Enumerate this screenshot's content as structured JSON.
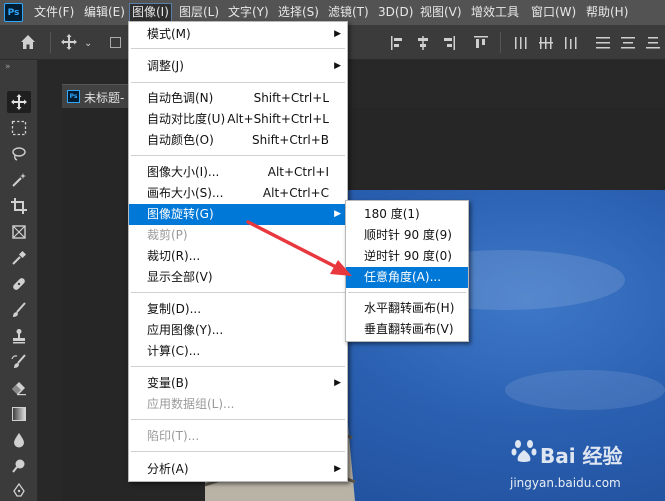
{
  "app": {
    "logo": "Ps"
  },
  "menubar": {
    "items": [
      "文件(F)",
      "编辑(E)",
      "图像(I)",
      "图层(L)",
      "文字(Y)",
      "选择(S)",
      "滤镜(T)",
      "3D(D)",
      "视图(V)",
      "增效工具",
      "窗口(W)",
      "帮助(H)"
    ],
    "active_index": 2
  },
  "document": {
    "tab_title": "未标题-"
  },
  "image_menu": {
    "items": [
      {
        "label": "模式(M)",
        "shortcut": "",
        "submenu": true,
        "disabled": false
      },
      {
        "label": "调整(J)",
        "shortcut": "",
        "submenu": true,
        "disabled": false
      },
      {
        "label": "自动色调(N)",
        "shortcut": "Shift+Ctrl+L",
        "submenu": false,
        "disabled": false
      },
      {
        "label": "自动对比度(U)",
        "shortcut": "Alt+Shift+Ctrl+L",
        "submenu": false,
        "disabled": false
      },
      {
        "label": "自动颜色(O)",
        "shortcut": "Shift+Ctrl+B",
        "submenu": false,
        "disabled": false
      },
      {
        "label": "图像大小(I)...",
        "shortcut": "Alt+Ctrl+I",
        "submenu": false,
        "disabled": false
      },
      {
        "label": "画布大小(S)...",
        "shortcut": "Alt+Ctrl+C",
        "submenu": false,
        "disabled": false
      },
      {
        "label": "图像旋转(G)",
        "shortcut": "",
        "submenu": true,
        "disabled": false,
        "highlighted": true
      },
      {
        "label": "裁剪(P)",
        "shortcut": "",
        "submenu": false,
        "disabled": true
      },
      {
        "label": "裁切(R)...",
        "shortcut": "",
        "submenu": false,
        "disabled": false
      },
      {
        "label": "显示全部(V)",
        "shortcut": "",
        "submenu": false,
        "disabled": false
      },
      {
        "label": "复制(D)...",
        "shortcut": "",
        "submenu": false,
        "disabled": false
      },
      {
        "label": "应用图像(Y)...",
        "shortcut": "",
        "submenu": false,
        "disabled": false
      },
      {
        "label": "计算(C)...",
        "shortcut": "",
        "submenu": false,
        "disabled": false
      },
      {
        "label": "变量(B)",
        "shortcut": "",
        "submenu": true,
        "disabled": false
      },
      {
        "label": "应用数据组(L)...",
        "shortcut": "",
        "submenu": false,
        "disabled": true
      },
      {
        "label": "陷印(T)...",
        "shortcut": "",
        "submenu": false,
        "disabled": true
      },
      {
        "label": "分析(A)",
        "shortcut": "",
        "submenu": true,
        "disabled": false
      }
    ]
  },
  "rotate_submenu": {
    "items": [
      {
        "label": "180 度(1)"
      },
      {
        "label": "顺时针 90 度(9)"
      },
      {
        "label": "逆时针 90 度(0)"
      },
      {
        "label": "任意角度(A)...",
        "highlighted": true
      },
      {
        "label": "水平翻转画布(H)"
      },
      {
        "label": "垂直翻转画布(V)"
      }
    ]
  },
  "icons": {
    "home": "home-icon",
    "move": "move-icon",
    "marquee": "marquee-icon",
    "lasso": "lasso-icon",
    "magic_wand": "magic-wand-icon",
    "crop": "crop-icon",
    "frame": "frame-icon",
    "eyedropper": "eyedropper-icon",
    "healing": "healing-brush-icon",
    "brush": "brush-icon",
    "stamp": "clone-stamp-icon",
    "history_brush": "history-brush-icon",
    "eraser": "eraser-icon",
    "gradient": "gradient-icon",
    "blur": "blur-icon",
    "dodge": "dodge-icon",
    "pen": "pen-icon"
  },
  "colors": {
    "menu_highlight": "#0078d7",
    "annotation_arrow": "#e8383d",
    "photo_sky": "#2a5fb0"
  },
  "watermark": {
    "brand": "Bai 经验",
    "url": "jingyan.baidu.com"
  }
}
